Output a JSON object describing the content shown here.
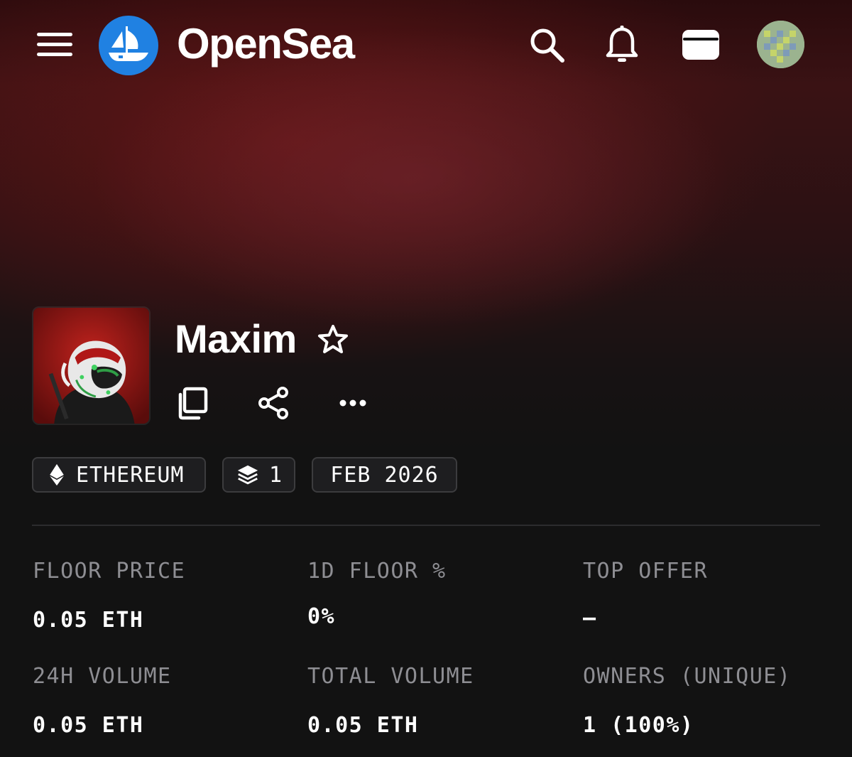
{
  "header": {
    "brand": "OpenSea",
    "icons": [
      "menu-icon",
      "opensea-logo",
      "search-icon",
      "bell-icon",
      "wallet-icon",
      "avatar"
    ]
  },
  "collection": {
    "name": "Maxim",
    "actions": [
      "copy-icon",
      "share-icon",
      "more-icon"
    ],
    "chips": {
      "chain": "ETHEREUM",
      "items_count": "1",
      "created": "FEB 2026"
    }
  },
  "stats": [
    {
      "label": "FLOOR PRICE",
      "value": "0.05 ETH"
    },
    {
      "label": "1D FLOOR %",
      "value": "0%"
    },
    {
      "label": "TOP OFFER",
      "value": "–"
    },
    {
      "label": "24H VOLUME",
      "value": "0.05 ETH"
    },
    {
      "label": "TOTAL VOLUME",
      "value": "0.05 ETH"
    },
    {
      "label": "OWNERS (UNIQUE)",
      "value": "1 (100%)"
    }
  ],
  "colors": {
    "brand_blue": "#2081e2",
    "background": "#121212",
    "banner_red": "#6e1616",
    "muted_text": "#8e8e93"
  }
}
